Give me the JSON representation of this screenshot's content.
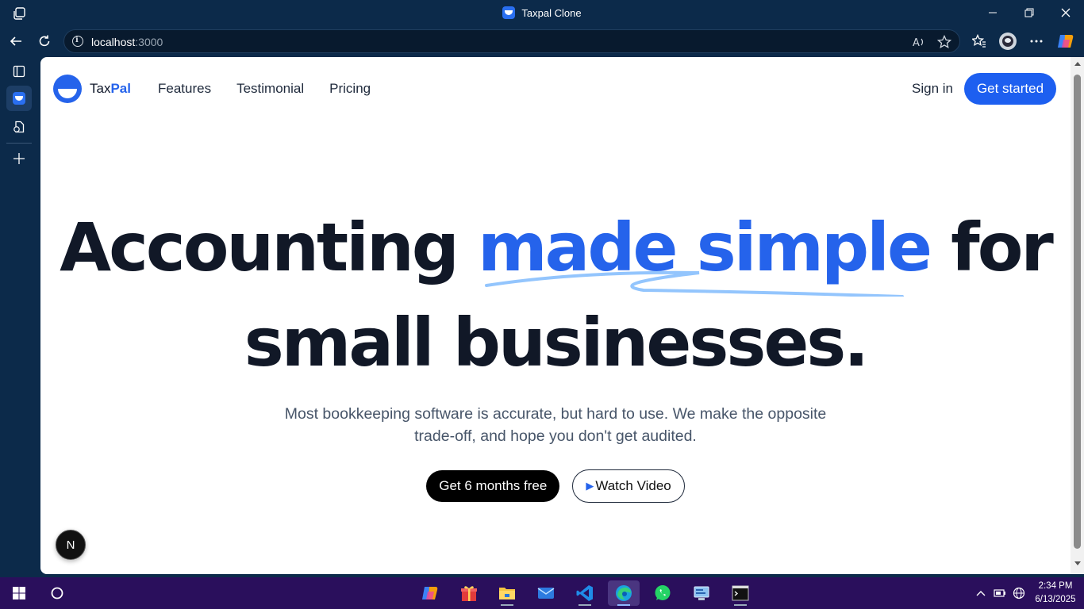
{
  "browser": {
    "window_title": "Taxpal Clone",
    "url_host": "localhost",
    "url_port": ":3000"
  },
  "site": {
    "logo_tax": "Tax",
    "logo_pal": "Pal",
    "nav": [
      "Features",
      "Testimonial",
      "Pricing"
    ],
    "signin_label": "Sign in",
    "get_started_label": "Get started"
  },
  "hero": {
    "line1_a": "Accounting ",
    "line1_highlight": "made simple",
    "line1_b": " for",
    "line2": "small businesses.",
    "subtitle_line1": "Most bookkeeping software is accurate, but hard to use. We make the opposite",
    "subtitle_line2": "trade-off, and hope you don't get audited.",
    "primary_cta": "Get 6 months free",
    "secondary_cta": "Watch Video",
    "play_glyph": "▶",
    "next_badge": "N"
  },
  "taskbar": {
    "time": "2:34 PM",
    "date": "6/13/2025"
  },
  "colors": {
    "brand": "#2563eb",
    "titlebar": "#0c2a4a",
    "taskbar": "#2a0f5c"
  }
}
